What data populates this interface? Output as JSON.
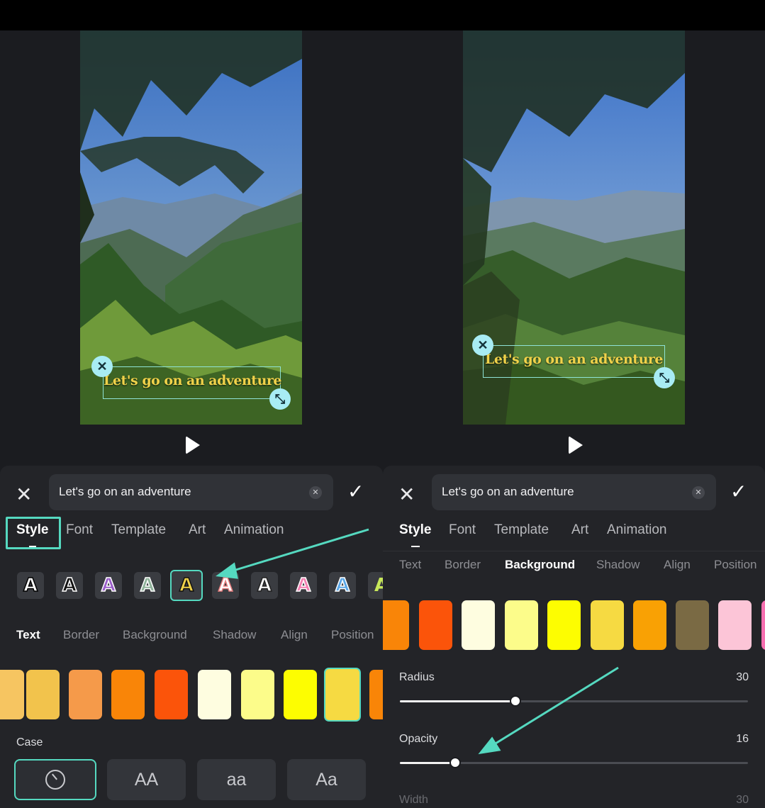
{
  "overlay_text": "Let's go on an adventure",
  "editor": {
    "input_value": "Let's go on an adventure",
    "tabs": [
      "Style",
      "Font",
      "Template",
      "Art",
      "Animation"
    ],
    "subtabs": [
      "Text",
      "Border",
      "Background",
      "Shadow",
      "Align",
      "Position"
    ]
  },
  "left": {
    "style_glyph": "A",
    "case_label": "Case",
    "case_options": [
      "AA",
      "aa",
      "Aa"
    ]
  },
  "right": {
    "radius_label": "Radius",
    "radius_value": "30",
    "opacity_label": "Opacity",
    "opacity_value": "16",
    "width_label": "Width",
    "width_value": "30"
  },
  "colors": {
    "accent": "#55d9c0",
    "text_overlay": "#f0d24a",
    "left_swatches": [
      "#f6c561",
      "#f2c34c",
      "#f59a4a",
      "#f98508",
      "#fb540a",
      "#fefde0",
      "#fcfc8a",
      "#fdfd01",
      "#f6da42",
      "#f98508"
    ],
    "right_swatches": [
      "#f98508",
      "#fb540a",
      "#fefde0",
      "#fcfc8a",
      "#fdfd01",
      "#f6da42",
      "#f9a104",
      "#7a6a44",
      "#fcc5d7",
      "#f76fb0"
    ]
  }
}
